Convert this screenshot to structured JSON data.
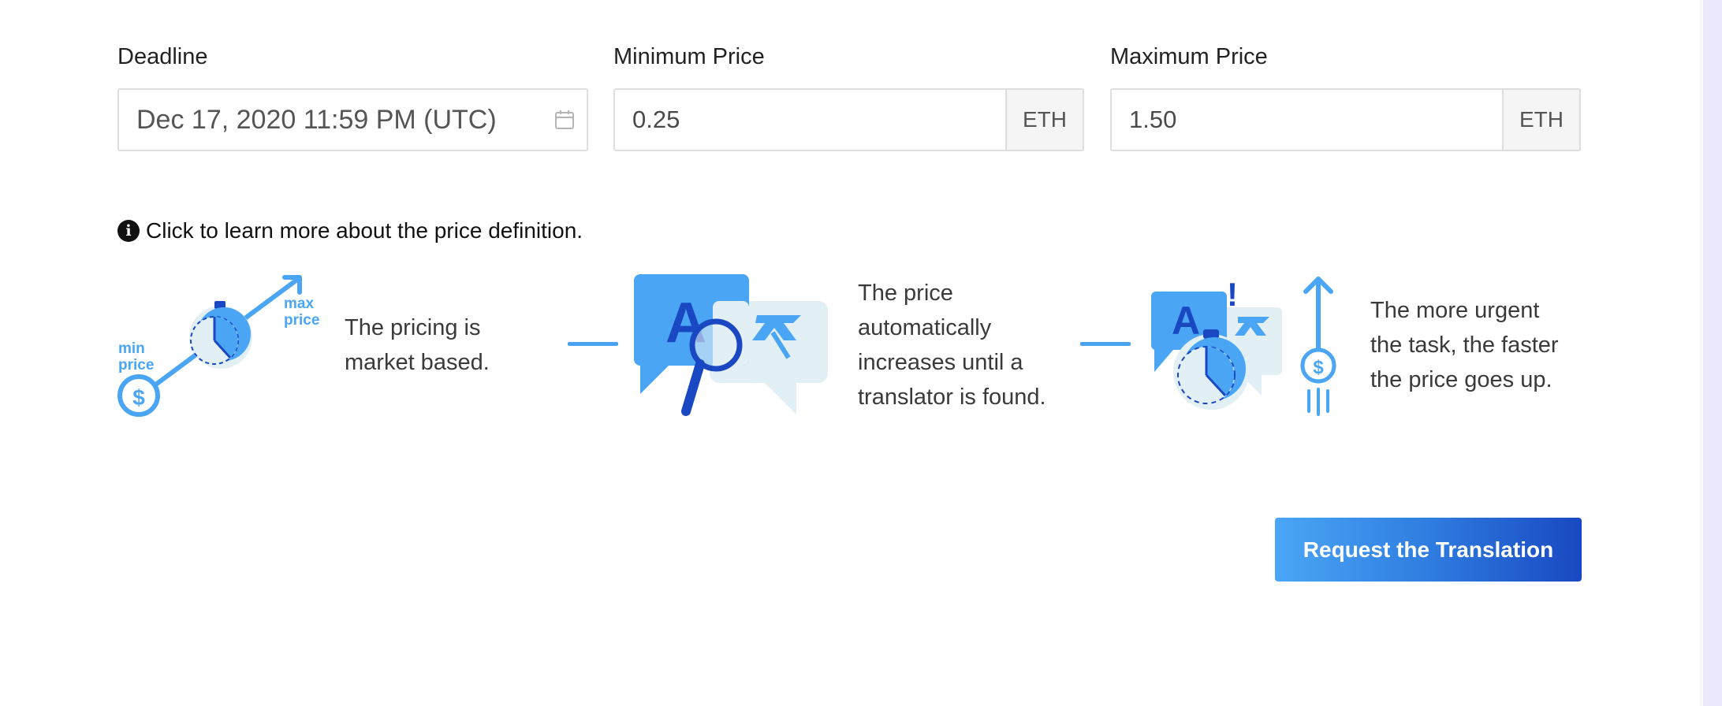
{
  "form": {
    "deadline": {
      "label": "Deadline",
      "value": "Dec 17, 2020 11:59 PM (UTC)",
      "icon": "calendar-icon"
    },
    "min_price": {
      "label": "Minimum Price",
      "value": "0.25",
      "unit": "ETH"
    },
    "max_price": {
      "label": "Maximum Price",
      "value": "1.50",
      "unit": "ETH"
    }
  },
  "info": {
    "icon": "info-icon",
    "text": "Click to learn more about the price definition."
  },
  "steps": [
    {
      "lines": [
        "The pricing is",
        "market based."
      ],
      "illus_labels": {
        "min": [
          "min",
          "price"
        ],
        "max": [
          "max",
          "price"
        ]
      }
    },
    {
      "lines": [
        "The price",
        "automatically",
        "increases until a",
        "translator is found."
      ],
      "illus_glyph": "A"
    },
    {
      "lines": [
        "The more urgent",
        "the task, the faster",
        "the price goes up."
      ],
      "illus_glyph": "A"
    }
  ],
  "dollar_symbol": "$",
  "exclamation": "!",
  "cta": {
    "label": "Request the Translation"
  },
  "colors": {
    "accent_light": "#4aa6f5",
    "accent_dark": "#1948c2",
    "pale": "#e2eff5"
  }
}
